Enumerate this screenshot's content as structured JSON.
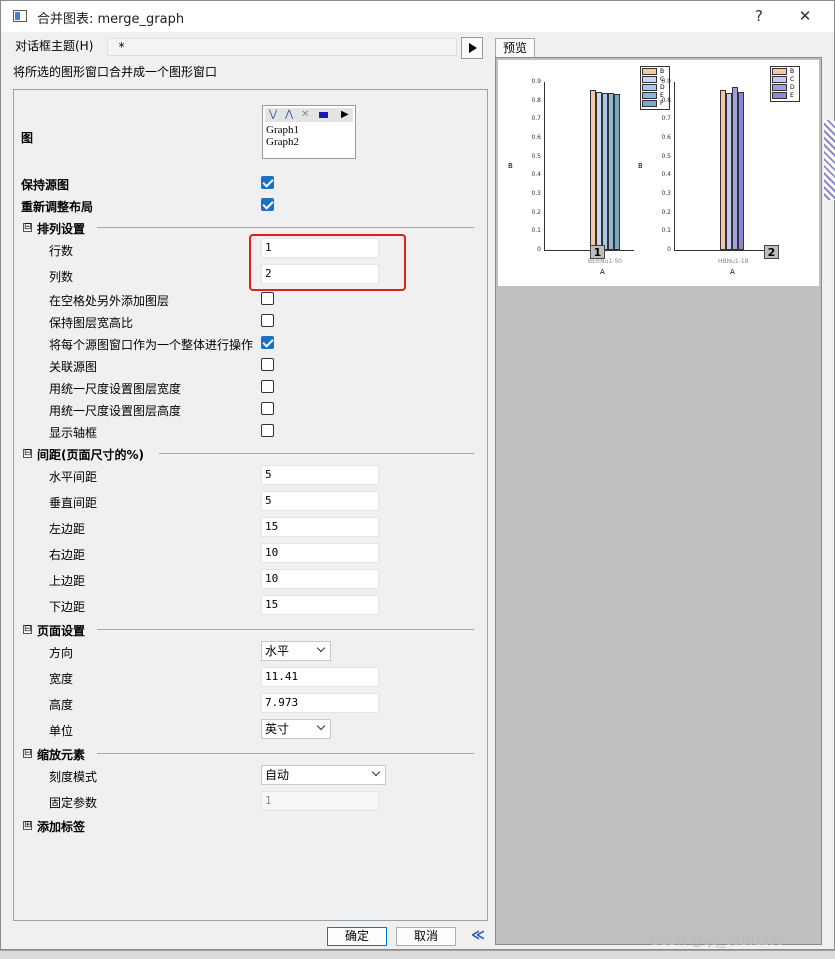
{
  "window": {
    "title": "合并图表: merge_graph",
    "help_glyph": "?",
    "close_glyph": "✕"
  },
  "theme": {
    "label": "对话框主题(H)",
    "value": "*"
  },
  "description": "将所选的图形窗口合并成一个图形窗口",
  "graphs": {
    "label": "图",
    "items": [
      "Graph1",
      "Graph2"
    ]
  },
  "options": {
    "keep_source": {
      "label": "保持源图",
      "checked": true
    },
    "relayout": {
      "label": "重新调整布局",
      "checked": true
    }
  },
  "arrange": {
    "header": "排列设置",
    "expander": "⊟",
    "rows_label": "行数",
    "rows_value": "1",
    "cols_label": "列数",
    "cols_value": "2",
    "checks": [
      {
        "label": "在空格处另外添加图层",
        "checked": false
      },
      {
        "label": "保持图层宽高比",
        "checked": false
      },
      {
        "label": "将每个源图窗口作为一个整体进行操作",
        "checked": true
      },
      {
        "label": "关联源图",
        "checked": false
      },
      {
        "label": "用统一尺度设置图层宽度",
        "checked": false
      },
      {
        "label": "用统一尺度设置图层高度",
        "checked": false
      },
      {
        "label": "显示轴框",
        "checked": false
      }
    ]
  },
  "spacing": {
    "header": "间距(页面尺寸的%)",
    "expander": "⊟",
    "rows": [
      {
        "label": "水平间距",
        "value": "5"
      },
      {
        "label": "垂直间距",
        "value": "5"
      },
      {
        "label": "左边距",
        "value": "15"
      },
      {
        "label": "右边距",
        "value": "10"
      },
      {
        "label": "上边距",
        "value": "10"
      },
      {
        "label": "下边距",
        "value": "15"
      }
    ]
  },
  "page": {
    "header": "页面设置",
    "expander": "⊟",
    "orientation_label": "方向",
    "orientation_value": "水平",
    "width_label": "宽度",
    "width_value": "11.41",
    "height_label": "高度",
    "height_value": "7.973",
    "unit_label": "单位",
    "unit_value": "英寸"
  },
  "scale": {
    "header": "缩放元素",
    "expander": "⊟",
    "mode_label": "刻度模式",
    "mode_value": "自动",
    "fixed_label": "固定参数",
    "fixed_value": "1"
  },
  "labels": {
    "header": "添加标签",
    "expander": "⊞"
  },
  "buttons": {
    "ok": "确定",
    "cancel": "取消",
    "collapse": "≪"
  },
  "preview": {
    "tab": "预览",
    "panel1": {
      "badge": "1",
      "y_ticks": [
        "0.9",
        "0.8",
        "0.7",
        "0.6",
        "0.5",
        "0.4",
        "0.3",
        "0.2",
        "0.1",
        "0"
      ],
      "y_label": "B",
      "x_label": "A",
      "x_category": "BERNu1-50",
      "legend": [
        "B",
        "C",
        "D",
        "E",
        "F"
      ]
    },
    "panel2": {
      "badge": "2",
      "y_ticks": [
        "0.9",
        "0.8",
        "0.7",
        "0.6",
        "0.5",
        "0.4",
        "0.3",
        "0.2",
        "0.1",
        "0"
      ],
      "y_label": "B",
      "x_label": "A",
      "x_category": "HBNu1-18",
      "legend": [
        "B",
        "C",
        "D",
        "E"
      ]
    }
  },
  "colors": {
    "accent": "#1f6fc2",
    "highlight": "#e02020",
    "bar_fills": [
      "#f2c9a8",
      "#c8d8f0",
      "#a8c8e8",
      "#8fb6d6",
      "#7aa8c8"
    ],
    "bar_fills_2": [
      "#f2c9a8",
      "#c8c8f0",
      "#a0a0e0",
      "#8a8ad0"
    ]
  },
  "watermark": "CSDN @qq_38101208"
}
